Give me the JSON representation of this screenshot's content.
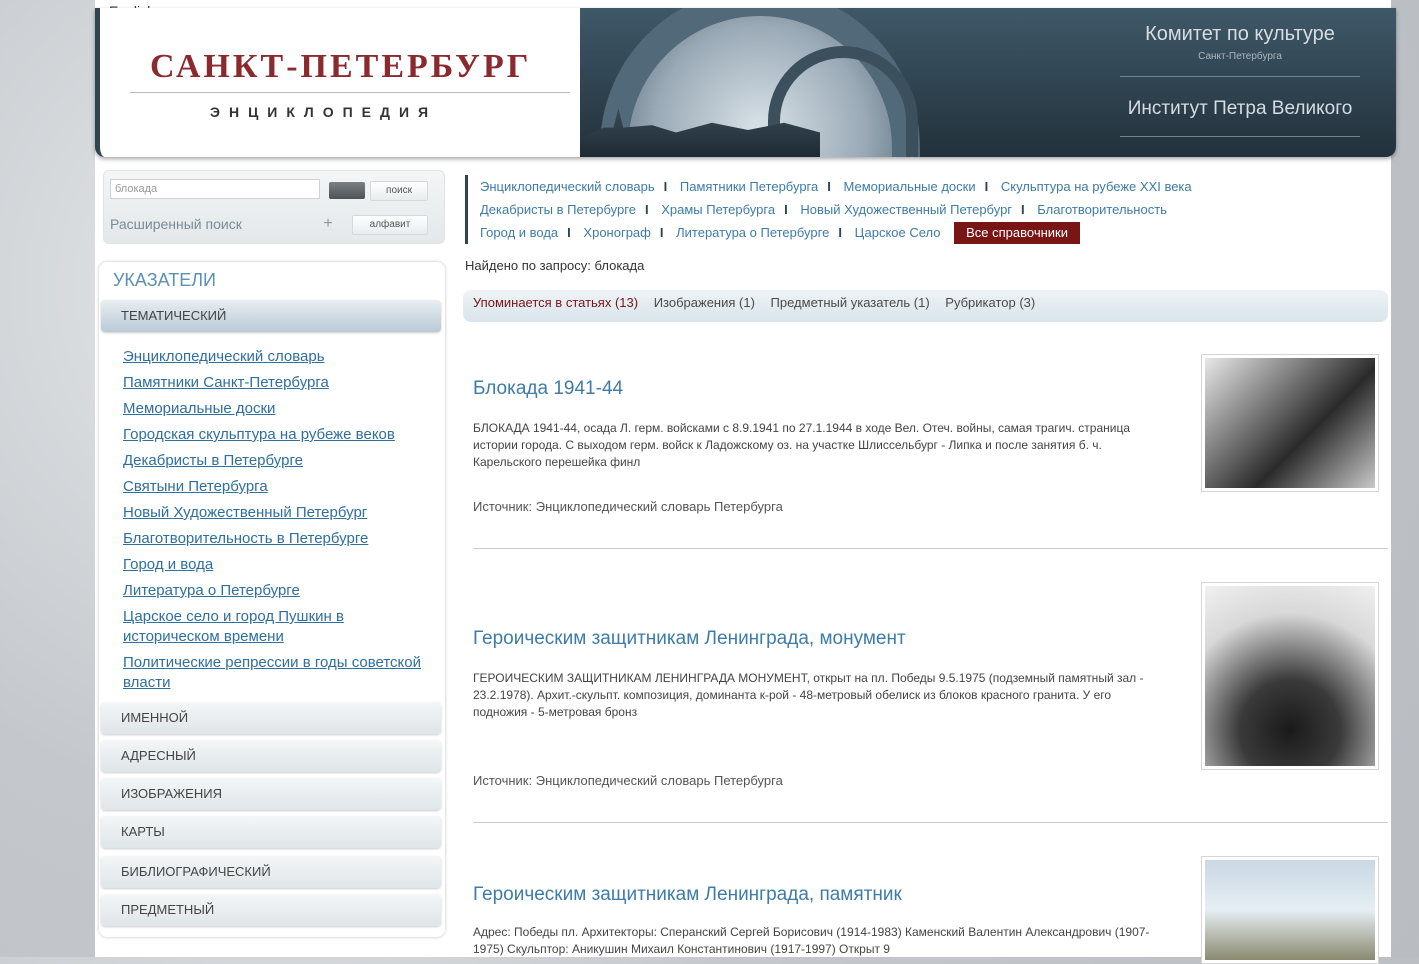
{
  "lang": "English",
  "header": {
    "title": "САНКТ-ПЕТЕРБУРГ",
    "subtitle": "ЭНЦИКЛОПЕДИЯ",
    "institution_1": "Комитет по культуре",
    "institution_1_sub": "Санкт-Петербурга",
    "institution_2": "Институт Петра Великого"
  },
  "search": {
    "value": "блокада",
    "search_button": "поиск",
    "advanced_link": "Расширенный поиск",
    "plus_label": "+",
    "alphabet_button": "алфавит"
  },
  "nav": {
    "links": [
      "Энциклопедический словарь",
      "Памятники Петербурга",
      "Мемориальные доски",
      "Скульптура на рубеже XXI века",
      "Декабристы в Петербурге",
      "Храмы Петербурга",
      "Новый Художественный Петербург",
      "Благотворительность",
      "Город и вода",
      "Хронограф",
      "Литература о Петербурге",
      "Царское Село"
    ],
    "separator": "I",
    "all_directories": "Все справочники"
  },
  "index": {
    "title": "УКАЗАТЕЛИ",
    "tabs": [
      "ТЕМАТИЧЕСКИЙ",
      "ИМЕННОЙ",
      "АДРЕСНЫЙ",
      "ИЗОБРАЖЕНИЯ",
      "КАРТЫ",
      "БИБЛИОГРАФИЧЕСКИЙ",
      "ПРЕДМЕТНЫЙ"
    ],
    "links": [
      "Энциклопедический словарь",
      "Памятники Санкт-Петербурга",
      "Мемориальные доски",
      "Городская скульптура на рубеже веков",
      "Декабристы в Петербурге",
      "Святыни Петербурга",
      "Новый Художественный Петербург",
      "Благотворительность в Петербурге",
      "Город и вода",
      "Литература о Петербурге",
      "Царское село и город Пушкин в историческом времени",
      "Политические репрессии в годы советской власти"
    ]
  },
  "results": {
    "query_label": "Найдено по запросу: блокада",
    "tabs": [
      "Упоминается в статьях (13)",
      "Изображения (1)",
      "Предметный указатель (1)",
      "Рубрикатор (3)"
    ],
    "items": [
      {
        "title": "Блокада 1941-44",
        "text": "БЛОКАДА 1941-44, осада Л. герм. войсками с 8.9.1941 по 27.1.1944 в ходе Вел. Отеч. войны, самая трагич. страница истории города. С выходом герм. войск к Ладожскому оз. на участке Шлиссельбург - Липка и после занятия б. ч. Карельского перешейка финл",
        "source": "Источник: Энциклопедический словарь Петербурга"
      },
      {
        "title": "Героическим защитникам Ленинграда, монумент",
        "text": "ГЕРОИЧЕСКИМ ЗАЩИТНИКАМ ЛЕНИНГРАДА МОНУМЕНТ, открыт на пл. Победы 9.5.1975 (подземный памятный зал - 23.2.1978). Архит.-скульпт. композиция, доминанта к-рой - 48-метровый обелиск из блоков красного гранита. У его подножия - 5-метровая бронз",
        "source": "Источник: Энциклопедический словарь Петербурга"
      },
      {
        "title": "Героическим защитникам Ленинграда, памятник",
        "text": "Адрес: Победы пл. Архитекторы: Сперанский Сергей Борисович (1914-1983) Каменский Валентин Александрович (1907-1975) Скульптор: Аникушин Михаил Константинович (1917-1997) Открыт 9",
        "source": ""
      }
    ]
  }
}
